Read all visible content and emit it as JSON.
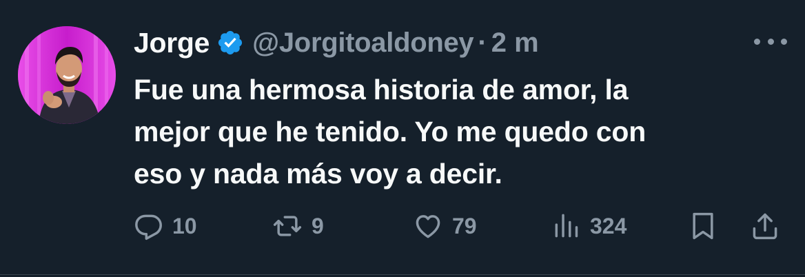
{
  "tweet": {
    "name": "Jorge",
    "handle": "@Jorgitoaldoney",
    "separator": "·",
    "time": "2 m",
    "text_lines": [
      "Fue una hermosa historia de amor, la",
      "mejor que he tenido. Yo me quedo con",
      "eso y nada más voy a decir."
    ],
    "verified": true
  },
  "actions": {
    "replies": "10",
    "retweets": "9",
    "likes": "79",
    "views": "324"
  },
  "icons": {
    "reply": "reply-icon",
    "retweet": "retweet-icon",
    "like": "heart-icon",
    "views": "views-icon",
    "bookmark": "bookmark-icon",
    "share": "share-icon",
    "more": "more-icon",
    "verified": "verified-badge-icon"
  },
  "colors": {
    "background": "#15202b",
    "text": "#f7f9f9",
    "secondary": "#8b98a5",
    "verified": "#1d9bf0",
    "avatar_background": "#d21fd6"
  }
}
